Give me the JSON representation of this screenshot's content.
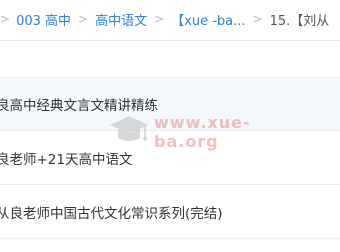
{
  "breadcrumb": {
    "items": [
      {
        "label": "003 高中"
      },
      {
        "label": "高中语文"
      },
      {
        "label": "【xue -ba..."
      },
      {
        "label": "15.【刘从"
      }
    ],
    "separator": ">"
  },
  "files": [
    {
      "name": "良高中经典文言文精讲精练"
    },
    {
      "name": "良老师+21天高中语文"
    },
    {
      "name": "从良老师中国古代文化常识系列(完结)"
    }
  ],
  "watermark": {
    "text": "www.xue-ba.org",
    "icon": "graduation-cap-icon"
  },
  "colors": {
    "link": "#2f7fdb",
    "text": "#333333",
    "highlight_row": "#f4f7fc",
    "watermark": "#e68c8c"
  }
}
